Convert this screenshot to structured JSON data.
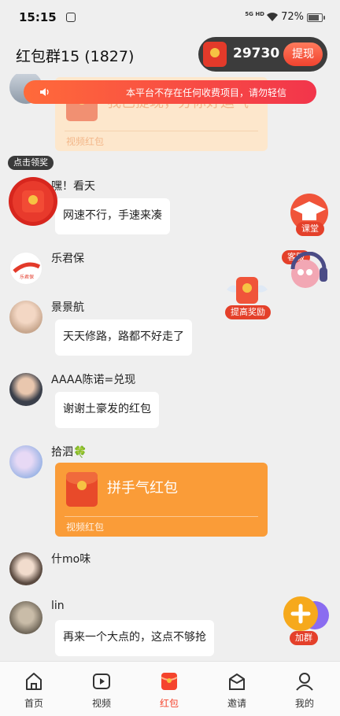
{
  "status_bar": {
    "time": "15:15",
    "network": "5G HD",
    "battery": "72%",
    "battery_level": 0.72
  },
  "header": {
    "title": "红包群15 (1827)",
    "coins": "29730",
    "withdraw_label": "提现"
  },
  "notice": {
    "text": "本平台不存在任何收费项目，请勿轻信"
  },
  "messages": [
    {
      "type": "redpacket",
      "state": "opened",
      "label": "我已提现，分你好运气",
      "kind": "视频红包"
    },
    {
      "type": "text",
      "name": "嘿！看天",
      "text": "网速不行，手速来凑"
    },
    {
      "type": "text",
      "name": "乐君保",
      "text": ""
    },
    {
      "type": "text",
      "name": "景景航",
      "text": "天天修路，路都不好走了"
    },
    {
      "type": "text",
      "name": "AAAA陈诺=兑现",
      "text": "谢谢土豪发的红包"
    },
    {
      "type": "redpacket",
      "name": "拾泗🍀",
      "state": "new",
      "label": "拼手气红包",
      "kind": "视频红包"
    },
    {
      "type": "text",
      "name": "什mo味",
      "text": ""
    },
    {
      "type": "text",
      "name": "lin",
      "text": "再来一个大点的，这点不够抢"
    }
  ],
  "floating": {
    "claim_label": "点击领奖",
    "course_label": "课堂",
    "service_label": "客服",
    "reward_label": "提高奖励",
    "join_label": "加群",
    "logo_text": "乐君保"
  },
  "tabs": [
    {
      "label": "首页",
      "icon": "home-icon",
      "active": false
    },
    {
      "label": "视频",
      "icon": "video-icon",
      "active": false
    },
    {
      "label": "红包",
      "icon": "red-packet-icon",
      "active": true
    },
    {
      "label": "邀请",
      "icon": "invite-icon",
      "active": false
    },
    {
      "label": "我的",
      "icon": "profile-icon",
      "active": false
    }
  ],
  "colors": {
    "accent": "#f5442d",
    "redpacket": "#fa9c38",
    "background": "#efefef"
  }
}
